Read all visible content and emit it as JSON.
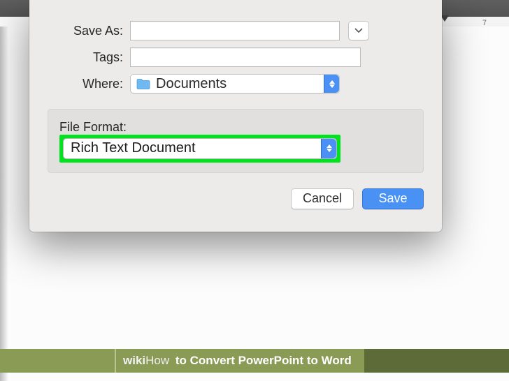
{
  "ruler": {
    "tick_label": "7"
  },
  "dialog": {
    "save_as_label": "Save As:",
    "save_as_value": "",
    "tags_label": "Tags:",
    "tags_value": "",
    "where_label": "Where:",
    "where_value": "Documents",
    "file_format_label": "File Format:",
    "file_format_value": "Rich Text Document",
    "cancel_label": "Cancel",
    "save_label": "Save"
  },
  "caption": {
    "brand_bold": "wiki",
    "brand_plain": "How",
    "title": "to Convert PowerPoint to Word"
  }
}
